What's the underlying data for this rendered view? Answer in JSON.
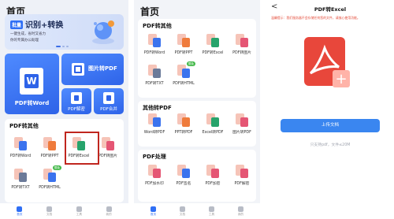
{
  "home": {
    "title": "首页",
    "banner": {
      "tag": "批量",
      "headline": "识别+转换",
      "line1": "一键生成，省时又省力",
      "line2": "你的专属办公助理"
    },
    "big_cards": {
      "word": "PDF转Word",
      "image_to_pdf": "图片转PDF",
      "decrypt": "PDF解密",
      "merge": "PDF合并"
    },
    "section": {
      "title": "PDF转其他",
      "items": [
        {
          "label": "PDF转Word",
          "color": "#3b73ee"
        },
        {
          "label": "PDF转PPT",
          "color": "#ef7b3c"
        },
        {
          "label": "PDF转Excel",
          "color": "#27a36b"
        },
        {
          "label": "PDF转图片",
          "color": "#e55674"
        },
        {
          "label": "PDF转TXT",
          "color": "#6b7a99"
        },
        {
          "label": "PDF转HTML",
          "color": "#3b73ee",
          "badge": "限免"
        }
      ]
    },
    "nav": [
      "首页",
      "文档",
      "工具",
      "我的"
    ]
  },
  "tools": {
    "title": "首页",
    "sections": [
      {
        "title": "PDF转其他",
        "items": [
          {
            "label": "PDF转Word",
            "color": "#3b73ee"
          },
          {
            "label": "PDF转PPT",
            "color": "#ef7b3c"
          },
          {
            "label": "PDF转Excel",
            "color": "#27a36b"
          },
          {
            "label": "PDF转图片",
            "color": "#e55674"
          },
          {
            "label": "PDF转TXT",
            "color": "#6b7a99"
          },
          {
            "label": "PDF转HTML",
            "color": "#3b73ee",
            "badge": "限免"
          }
        ]
      },
      {
        "title": "其他转PDF",
        "items": [
          {
            "label": "Word转PDF",
            "color": "#3b73ee"
          },
          {
            "label": "PPT转PDF",
            "color": "#ef7b3c"
          },
          {
            "label": "Excel转PDF",
            "color": "#27a36b"
          },
          {
            "label": "图片转PDF",
            "color": "#e55674"
          }
        ]
      },
      {
        "title": "PDF处理",
        "items": [
          {
            "label": "PDF加水印",
            "color": "#e55674"
          },
          {
            "label": "PDF签名",
            "color": "#3b73ee"
          },
          {
            "label": "PDF加密",
            "color": "#e55674"
          },
          {
            "label": "PDF解密",
            "color": "#e55674"
          }
        ]
      }
    ],
    "nav": [
      "首页",
      "文档",
      "工具",
      "我的"
    ]
  },
  "convert": {
    "back": "<",
    "title": "PDF转Excel",
    "warning": "温馨提示：我们服务器不会存储任何您的文件，请放心使用功能。",
    "upload_button": "上传文档",
    "upload_hint": "只支持pdf，文件≤20M"
  },
  "colors": {
    "primary": "#2f6ff5",
    "highlight": "#c0261e",
    "pdf_red": "#e8473b",
    "badge_green": "#43b849"
  }
}
